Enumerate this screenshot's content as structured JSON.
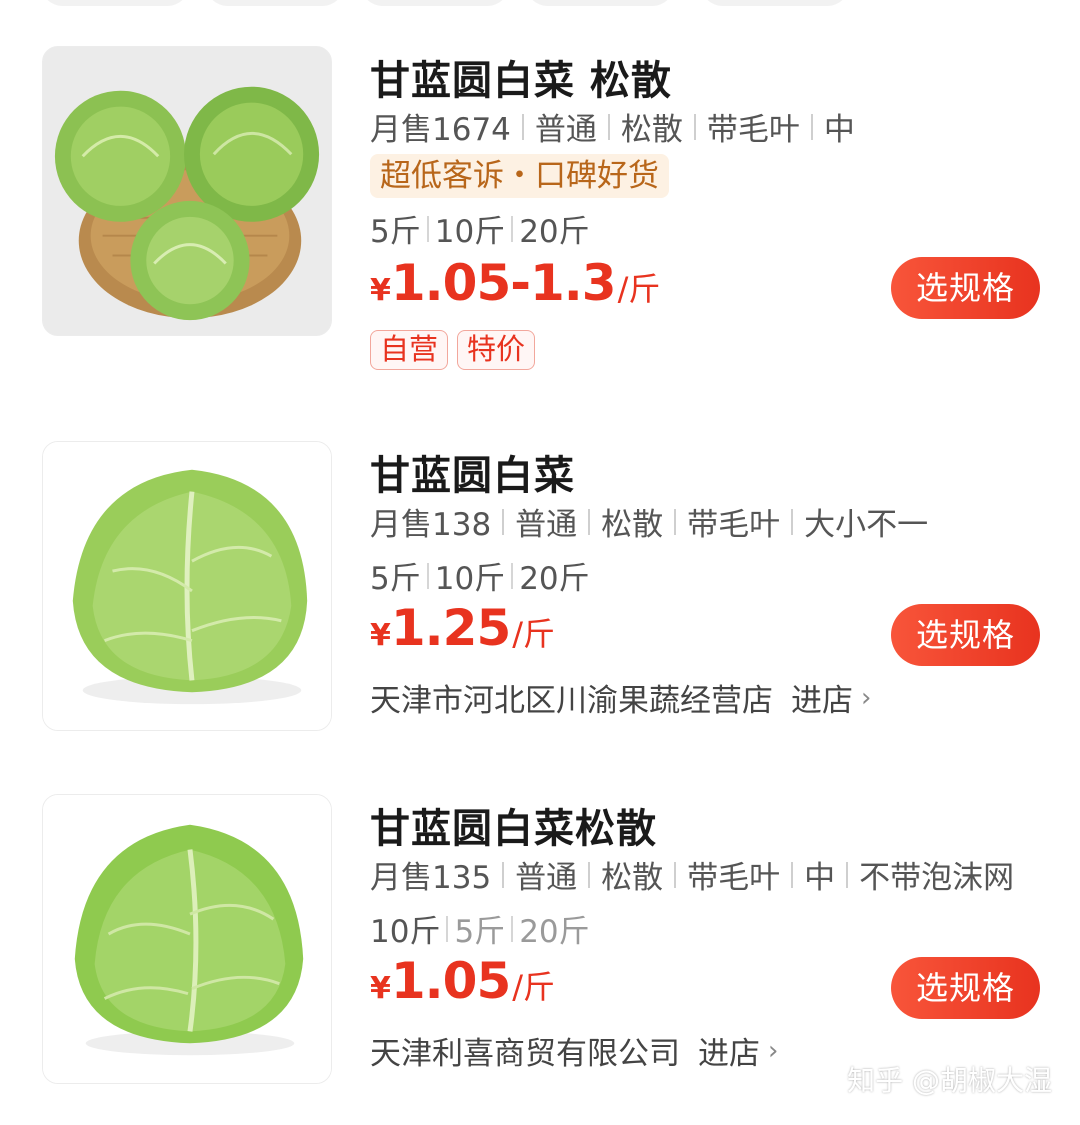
{
  "products": [
    {
      "title": "甘蓝圆白菜 松散",
      "specs": [
        "月售1674",
        "普通",
        "松散",
        "带毛叶",
        "中"
      ],
      "promo": "超低客诉・口碑好货",
      "weights": [
        "5斤",
        "10斤",
        "20斤"
      ],
      "price_yen": "¥",
      "price": "1.05-1.3",
      "price_unit": "/斤",
      "button": "选规格",
      "tags": [
        "自营",
        "特价"
      ]
    },
    {
      "title": "甘蓝圆白菜",
      "specs": [
        "月售138",
        "普通",
        "松散",
        "带毛叶",
        "大小不一"
      ],
      "weights": [
        "5斤",
        "10斤",
        "20斤"
      ],
      "price_yen": "¥",
      "price": "1.25",
      "price_unit": "/斤",
      "button": "选规格",
      "store": "天津市河北区川渝果蔬经营店",
      "enter": "进店",
      "chevron": "›"
    },
    {
      "title": "甘蓝圆白菜松散",
      "specs": [
        "月售135",
        "普通",
        "松散",
        "带毛叶",
        "中",
        "不带泡沫网"
      ],
      "weights": [
        "10斤",
        "5斤",
        "20斤"
      ],
      "price_yen": "¥",
      "price": "1.05",
      "price_unit": "/斤",
      "button": "选规格",
      "store": "天津利喜商贸有限公司",
      "enter": "进店",
      "chevron": "›"
    }
  ],
  "watermark": "知乎 @胡椒大湿",
  "colors": {
    "price": "#e8331f",
    "button": "#f04a2f",
    "promo_bg": "#fdf1e3",
    "promo_text": "#b8661a"
  }
}
